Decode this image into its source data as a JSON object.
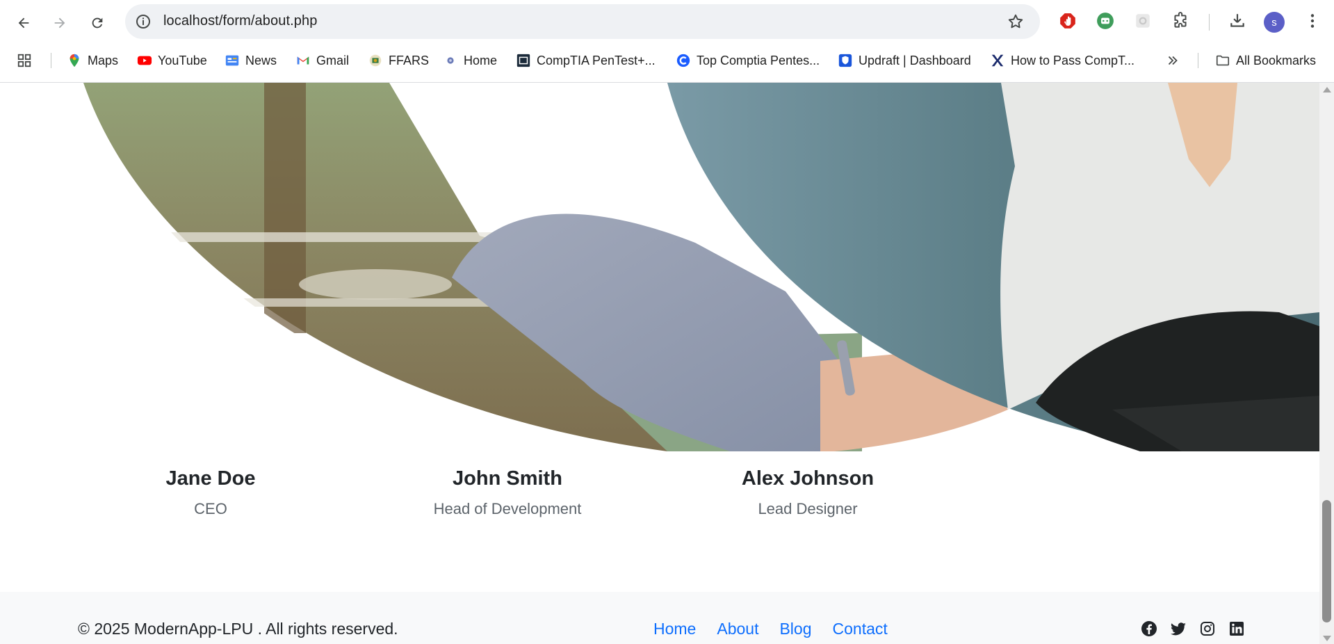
{
  "browser": {
    "url": "localhost/form/about.php",
    "avatar_initial": "s",
    "bookmarks": [
      {
        "label": "Maps",
        "icon": "maps-icon"
      },
      {
        "label": "YouTube",
        "icon": "youtube-icon"
      },
      {
        "label": "News",
        "icon": "news-icon"
      },
      {
        "label": "Gmail",
        "icon": "gmail-icon"
      },
      {
        "label": "FFARS",
        "icon": "ffars-icon"
      },
      {
        "label": "Home",
        "icon": "home-favicon"
      },
      {
        "label": "CompTIA PenTest+...",
        "icon": "comptia-icon"
      },
      {
        "label": "Top Comptia Pentes...",
        "icon": "c-icon"
      },
      {
        "label": "Updraft | Dashboard",
        "icon": "updraft-icon"
      },
      {
        "label": "How to Pass CompT...",
        "icon": "x-icon"
      }
    ],
    "all_bookmarks_label": "All Bookmarks"
  },
  "team": {
    "members": [
      {
        "name": "Jane Doe",
        "role": "CEO"
      },
      {
        "name": "John Smith",
        "role": "Head of Development"
      },
      {
        "name": "Alex Johnson",
        "role": "Lead Designer"
      }
    ]
  },
  "footer": {
    "copyright": "© 2025 ModernApp-LPU . All rights reserved.",
    "links": [
      "Home",
      "About",
      "Blog",
      "Contact"
    ],
    "socials": [
      "facebook-icon",
      "twitter-icon",
      "instagram-icon",
      "linkedin-icon"
    ]
  },
  "colors": {
    "link": "#0d6efd",
    "heading": "#212529",
    "muted": "#5c636a",
    "footer_bg": "#f8f9fa"
  }
}
